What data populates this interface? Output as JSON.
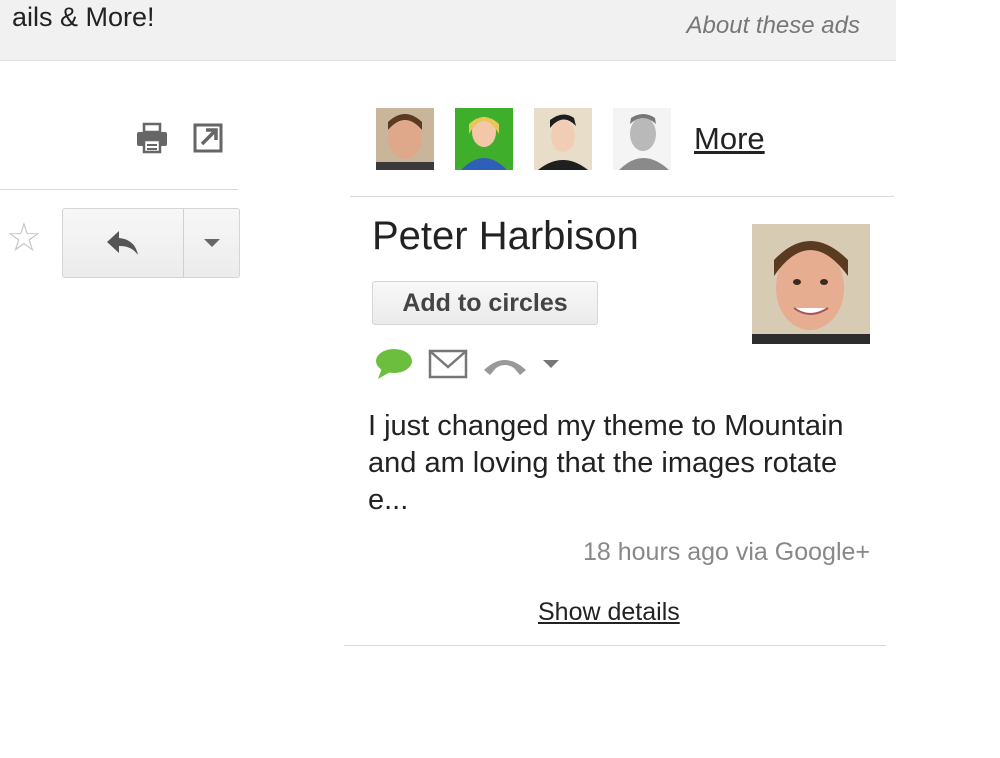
{
  "ad_banner": {
    "text": "ails & More!",
    "about_ads": "About these ads"
  },
  "toolbar": {
    "print_icon": "print-icon",
    "popout_icon": "popout-icon"
  },
  "message_actions": {
    "star_icon": "star-icon",
    "reply_icon": "reply-icon",
    "more_icon": "chevron-down-icon"
  },
  "people_widget": {
    "people": [
      {
        "icon": "avatar-photo"
      },
      {
        "icon": "avatar-photo"
      },
      {
        "icon": "avatar-photo"
      },
      {
        "icon": "avatar-photo"
      }
    ],
    "more_label": "More"
  },
  "profile": {
    "name": "Peter Harbison",
    "add_to_circles": "Add to circles",
    "contact_icons": [
      "chat-icon",
      "mail-icon",
      "phone-icon",
      "chevron-down-icon"
    ],
    "status_text": "I just changed my theme to Mountain and am loving that the images rotate e...",
    "timestamp": "18 hours ago via Google+",
    "show_details": "Show details"
  },
  "colors": {
    "chat_green": "#6cbf3e",
    "ad_bg": "#f1f1f1",
    "meta_gray": "#888888"
  }
}
